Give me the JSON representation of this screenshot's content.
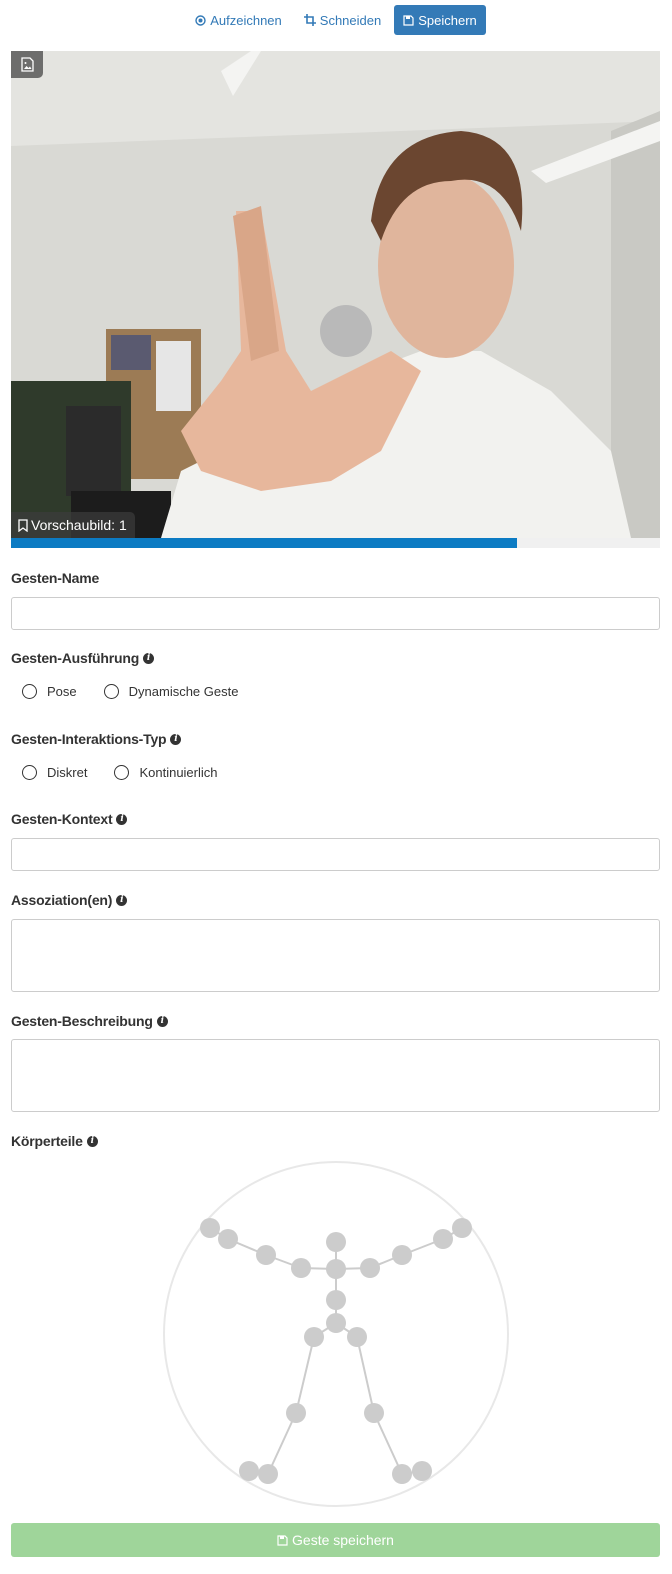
{
  "toolbar": {
    "record_label": "Aufzeichnen",
    "trim_label": "Schneiden",
    "save_label": "Speichern"
  },
  "video": {
    "thumbnail_label": "Vorschaubild: 1",
    "progress": 0.78
  },
  "form": {
    "name_label": "Gesten-Name",
    "name_value": "",
    "execution_label": "Gesten-Ausführung",
    "execution_options": [
      "Pose",
      "Dynamische Geste"
    ],
    "interaction_label": "Gesten-Interaktions-Typ",
    "interaction_options": [
      "Diskret",
      "Kontinuierlich"
    ],
    "context_label": "Gesten-Kontext",
    "context_value": "",
    "association_label": "Assoziation(en)",
    "association_value": "",
    "description_label": "Gesten-Beschreibung",
    "description_value": "",
    "bodyparts_label": "Körperteile"
  },
  "save_button_label": "Geste speichern",
  "colors": {
    "accent": "#337ab7",
    "progress": "#0c7bc3",
    "save_button": "#9fd59a",
    "joint": "#cccccc"
  }
}
